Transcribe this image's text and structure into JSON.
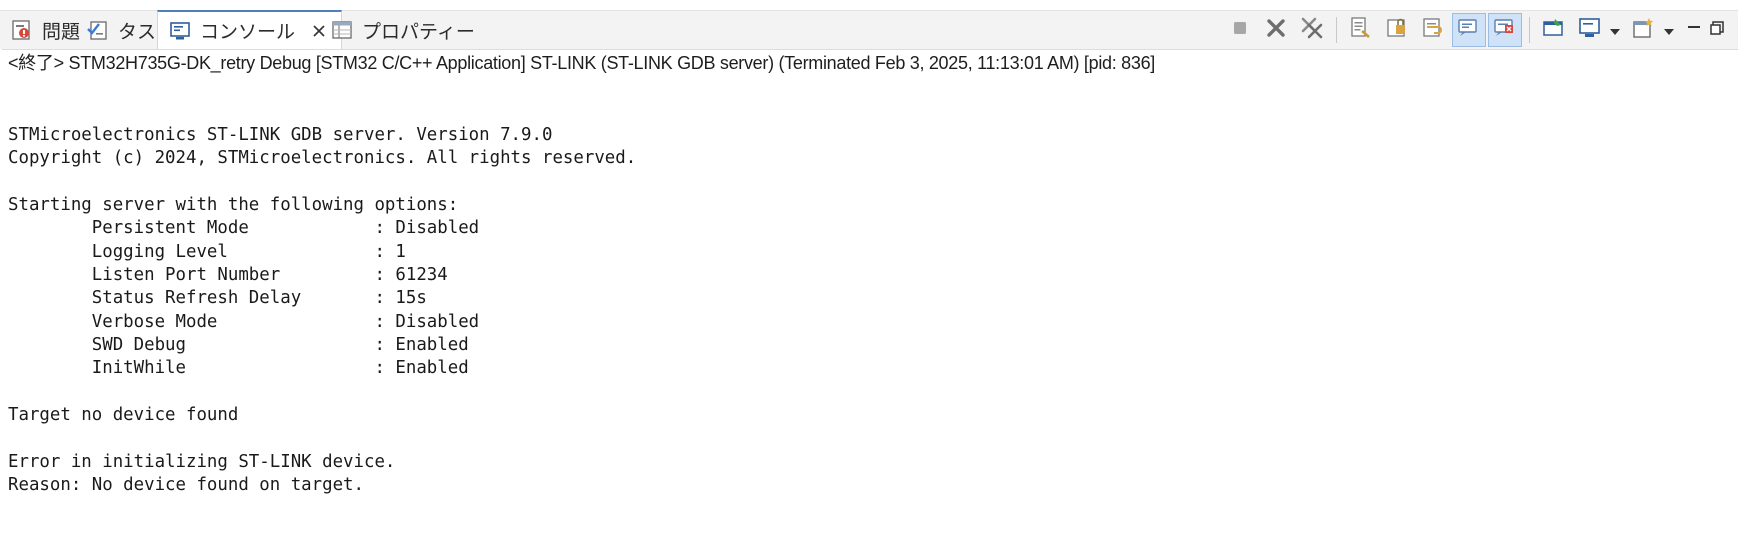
{
  "tabs": [
    {
      "label": "問題",
      "icon": "problems-icon",
      "active": false
    },
    {
      "label": "タスク",
      "icon": "tasks-icon",
      "active": false
    },
    {
      "label": "コンソール",
      "icon": "console-icon",
      "active": true
    },
    {
      "label": "プロパティー",
      "icon": "properties-icon",
      "active": false
    }
  ],
  "toolbar_icons": [
    "terminate-icon",
    "remove-launch-icon",
    "remove-all-terminated-icon",
    "clear-console-icon",
    "scroll-lock-icon",
    "word-wrap-icon",
    "show-console-on-stdout-icon",
    "show-console-on-stderr-icon",
    "pin-console-icon",
    "display-selected-console-icon",
    "open-console-icon",
    "minimize-icon",
    "maximize-icon"
  ],
  "console": {
    "title": "<終了> STM32H735G-DK_retry Debug [STM32 C/C++ Application] ST-LINK (ST-LINK GDB server) (Terminated Feb 3, 2025, 11:13:01 AM) [pid: 836]",
    "lines": [
      "STMicroelectronics ST-LINK GDB server. Version 7.9.0",
      "Copyright (c) 2024, STMicroelectronics. All rights reserved.",
      "",
      "Starting server with the following options:",
      "        Persistent Mode            : Disabled",
      "        Logging Level              : 1",
      "        Listen Port Number         : 61234",
      "        Status Refresh Delay       : 15s",
      "        Verbose Mode               : Disabled",
      "        SWD Debug                  : Enabled",
      "        InitWhile                  : Enabled",
      "",
      "Target no device found",
      "",
      "Error in initializing ST-LINK device.",
      "Reason: No device found on target."
    ]
  }
}
